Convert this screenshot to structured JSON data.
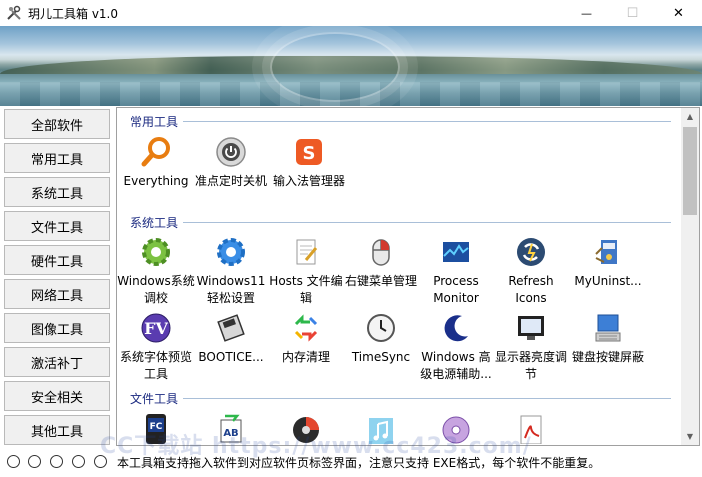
{
  "window": {
    "title": "玥儿工具箱 v1.0",
    "minimize_glyph": "—",
    "maximize_glyph": "☐",
    "close_glyph": "✕"
  },
  "sidebar": {
    "items": [
      {
        "label": "全部软件"
      },
      {
        "label": "常用工具"
      },
      {
        "label": "系统工具"
      },
      {
        "label": "文件工具"
      },
      {
        "label": "硬件工具"
      },
      {
        "label": "网络工具"
      },
      {
        "label": "图像工具"
      },
      {
        "label": "激活补丁"
      },
      {
        "label": "安全相关"
      },
      {
        "label": "其他工具"
      }
    ]
  },
  "groups": [
    {
      "title": "常用工具",
      "tools": [
        {
          "label": "Everything",
          "icon": "everything-icon"
        },
        {
          "label": "准点定时关机",
          "icon": "shutdown-timer-icon"
        },
        {
          "label": "输入法管理器",
          "icon": "ime-manager-icon"
        }
      ]
    },
    {
      "title": "系统工具",
      "tools": [
        {
          "label": "Windows系统调校",
          "icon": "windows-tuning-icon"
        },
        {
          "label": "Windows11轻松设置",
          "icon": "windows11-settings-icon"
        },
        {
          "label": "Hosts 文件编辑",
          "icon": "hosts-editor-icon"
        },
        {
          "label": "右键菜单管理",
          "icon": "context-menu-icon"
        },
        {
          "label": "Process Monitor",
          "icon": "process-monitor-icon"
        },
        {
          "label": "Refresh Icons",
          "icon": "refresh-icons-icon"
        },
        {
          "label": "MyUninst...",
          "icon": "myuninstaller-icon"
        },
        {
          "label": "系统字体预览工具",
          "icon": "font-viewer-icon"
        },
        {
          "label": "BOOTICE...",
          "icon": "bootice-icon"
        },
        {
          "label": "内存清理",
          "icon": "memory-clean-icon"
        },
        {
          "label": "TimeSync",
          "icon": "timesync-icon"
        },
        {
          "label": "Windows 高级电源辅助...",
          "icon": "power-assist-icon"
        },
        {
          "label": "显示器亮度调节",
          "icon": "monitor-brightness-icon"
        },
        {
          "label": "键盘按键屏蔽",
          "icon": "keyboard-block-icon"
        }
      ]
    },
    {
      "title": "文件工具",
      "tools": [
        {
          "label": "",
          "icon": "file-commander-icon"
        },
        {
          "label": "",
          "icon": "batch-rename-icon"
        },
        {
          "label": "",
          "icon": "disk-tool-icon"
        },
        {
          "label": "",
          "icon": "music-file-icon"
        },
        {
          "label": "",
          "icon": "disc-burner-icon"
        },
        {
          "label": "",
          "icon": "pdf-tool-icon"
        }
      ]
    }
  ],
  "status": {
    "text": "本工具箱支持拖入软件到对应软件页标签界面，注意只支持 EXE格式，每个软件不能重复。",
    "radio_count": 5
  },
  "watermark": "CC下载站  https://www.cc423.com/",
  "colors": {
    "group_title": "#1b2a80",
    "group_line": "#a9bfd8",
    "button_bg": "#f0f0f0"
  }
}
